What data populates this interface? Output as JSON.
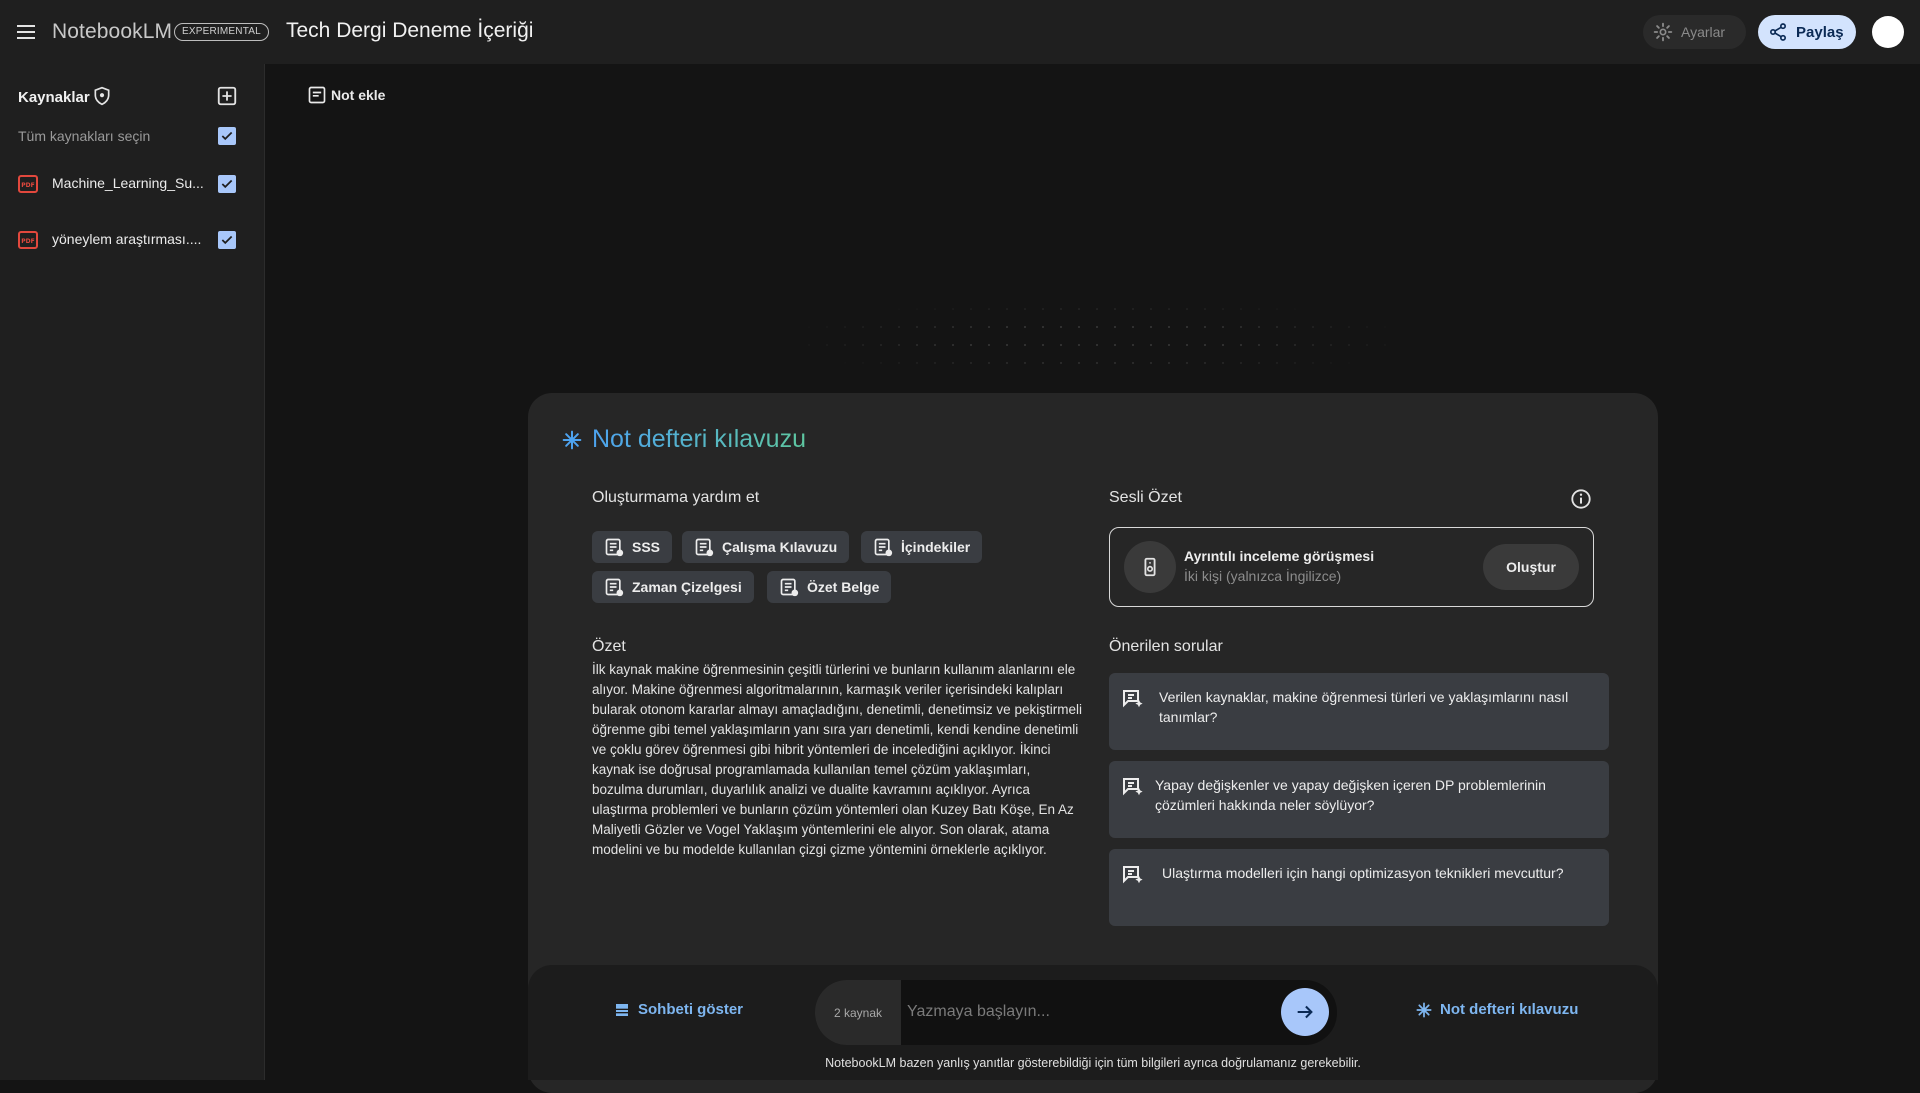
{
  "header": {
    "logo": "NotebookLM",
    "badge": "EXPERIMENTAL",
    "title": "Tech Dergi Deneme İçeriği",
    "settings_label": "Ayarlar",
    "share_label": "Paylaş"
  },
  "sidebar": {
    "title": "Kaynaklar",
    "select_all": "Tüm kaynakları seçin",
    "sources": [
      {
        "name": "Machine_Learning_Su...",
        "checked": true
      },
      {
        "name": "yöneylem araştırması....",
        "checked": true
      }
    ]
  },
  "main": {
    "add_note": "Not ekle"
  },
  "guide": {
    "title": "Not defteri kılavuzu",
    "help_heading": "Oluşturmama yardım et",
    "chips": [
      "SSS",
      "Çalışma Kılavuzu",
      "İçindekiler",
      "Zaman Çizelgesi",
      "Özet Belge"
    ],
    "summary_heading": "Özet",
    "summary_text": "İlk kaynak makine öğrenmesinin çeşitli türlerini ve bunların kullanım alanlarını ele alıyor. Makine öğrenmesi algoritmalarının, karmaşık veriler içerisindeki kalıpları bularak otonom kararlar almayı amaçladığını, denetimli, denetimsiz ve pekiştirmeli öğrenme gibi temel yaklaşımların yanı sıra yarı denetimli, kendi kendine denetimli ve çoklu görev öğrenmesi gibi hibrit yöntemleri de incelediğini açıklıyor. İkinci kaynak ise doğrusal programlamada kullanılan temel çözüm yaklaşımları, bozulma durumları, duyarlılık analizi ve dualite kavramını açıklıyor. Ayrıca ulaştırma problemleri ve bunların çözüm yöntemleri olan Kuzey Batı Köşe, En Az Maliyetli Gözler ve Vogel Yaklaşım yöntemlerini ele alıyor. Son olarak, atama modelini ve bu modelde kullanılan çizgi çizme yöntemini örneklerle açıklıyor.",
    "audio": {
      "heading": "Sesli Özet",
      "title": "Ayrıntılı inceleme görüşmesi",
      "subtitle": "İki kişi (yalnızca İngilizce)",
      "create_label": "Oluştur"
    },
    "suggested_heading": "Önerilen sorular",
    "questions": [
      "Verilen kaynaklar, makine öğrenmesi türleri ve yaklaşımlarını nasıl tanımlar?",
      "Yapay değişkenler ve yapay değişken içeren DP problemlerinin çözümleri hakkında neler söylüyor?",
      "Ulaştırma modelleri için hangi optimizasyon teknikleri mevcuttur?"
    ]
  },
  "chat": {
    "show_chat": "Sohbeti göster",
    "source_count": "2 kaynak",
    "placeholder": "Yazmaya başlayın...",
    "guide_link": "Not defteri kılavuzu",
    "disclaimer": "NotebookLM bazen yanlış yanıtlar gösterebildiği için tüm bilgileri ayrıca doğrulamanız gerekebilir."
  },
  "colors": {
    "accent_blue": "#a8c7fa",
    "link_blue": "#7eb6f0",
    "pdf_red": "#e2483d"
  }
}
